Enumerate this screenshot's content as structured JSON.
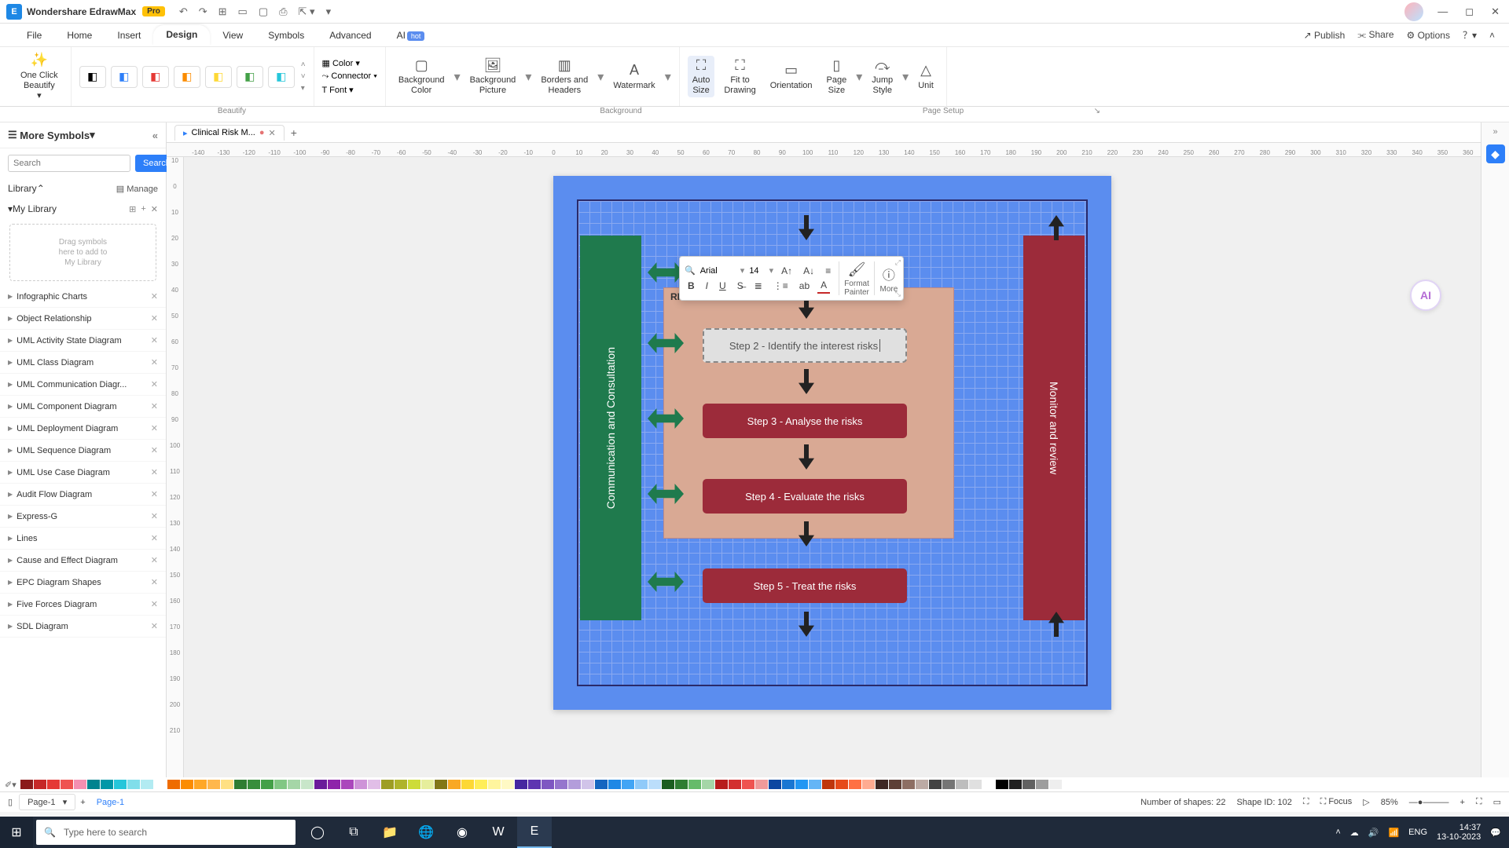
{
  "title": {
    "app": "Wondershare EdrawMax",
    "badge": "Pro"
  },
  "menu": {
    "items": [
      "File",
      "Home",
      "Insert",
      "Design",
      "View",
      "Symbols",
      "Advanced",
      "AI"
    ],
    "active": "Design",
    "hot": "hot",
    "right": {
      "publish": "Publish",
      "share": "Share",
      "options": "Options"
    }
  },
  "ribbon": {
    "one_click": "One Click\nBeautify",
    "color": "Color",
    "connector": "Connector",
    "font": "Font",
    "bg_color": "Background\nColor",
    "bg_picture": "Background\nPicture",
    "borders": "Borders and\nHeaders",
    "watermark": "Watermark",
    "auto_size": "Auto\nSize",
    "fit": "Fit to\nDrawing",
    "orientation": "Orientation",
    "page_size": "Page\nSize",
    "jump_style": "Jump\nStyle",
    "unit": "Unit",
    "groups": {
      "beautify": "Beautify",
      "background": "Background",
      "page_setup": "Page Setup"
    }
  },
  "left": {
    "title": "More Symbols",
    "search_placeholder": "Search",
    "search_btn": "Search",
    "library": "Library",
    "manage": "Manage",
    "mylib": "My Library",
    "dropzone": "Drag symbols\nhere to add to\nMy Library",
    "items": [
      "Infographic Charts",
      "Object Relationship",
      "UML Activity State Diagram",
      "UML Class Diagram",
      "UML Communication Diagr...",
      "UML Component Diagram",
      "UML Deployment Diagram",
      "UML Sequence Diagram",
      "UML Use Case Diagram",
      "Audit Flow Diagram",
      "Express-G",
      "Lines",
      "Cause and Effect Diagram",
      "EPC Diagram Shapes",
      "Five Forces Diagram",
      "SDL Diagram"
    ]
  },
  "doc_tab": {
    "name": "Clinical Risk M...",
    "dirty": "●"
  },
  "ruler_h": [
    "-140",
    "-130",
    "-120",
    "-110",
    "-100",
    "-90",
    "-80",
    "-70",
    "-60",
    "-50",
    "-40",
    "-30",
    "-20",
    "-10",
    "0",
    "10",
    "20",
    "30",
    "40",
    "50",
    "60",
    "70",
    "80",
    "90",
    "100",
    "110",
    "120",
    "130",
    "140",
    "150",
    "160",
    "170",
    "180",
    "190",
    "200",
    "210",
    "220",
    "230",
    "240",
    "250",
    "260",
    "270",
    "280",
    "290",
    "300",
    "310",
    "320",
    "330",
    "340",
    "350",
    "360"
  ],
  "ruler_v": [
    "10",
    "0",
    "10",
    "20",
    "30",
    "40",
    "50",
    "60",
    "70",
    "80",
    "90",
    "100",
    "110",
    "120",
    "130",
    "140",
    "150",
    "160",
    "170",
    "180",
    "190",
    "200",
    "210"
  ],
  "diagram": {
    "left_box": "Communication and Consultation",
    "right_box": "Monitor and review",
    "risk_title": "RISK ASSESSMENT",
    "step2": "Step 2 - Identify the interest risks",
    "step3": "Step 3 - Analyse the risks",
    "step4": "Step 4 - Evaluate the risks",
    "step5": "Step 5 - Treat the risks"
  },
  "float_toolbar": {
    "font": "Arial",
    "size": "14",
    "format_painter": "Format\nPainter",
    "more": "More"
  },
  "palette_colors": [
    "#8b1a1a",
    "#c62828",
    "#e53935",
    "#ef5350",
    "#f48fb1",
    "#00838f",
    "#0097a7",
    "#26c6da",
    "#80deea",
    "#b2ebf2",
    "#ffffff",
    "#ef6c00",
    "#fb8c00",
    "#ffa726",
    "#ffb74d",
    "#ffe082",
    "#2e7d32",
    "#388e3c",
    "#43a047",
    "#81c784",
    "#a5d6a7",
    "#c8e6c9",
    "#6a1b9a",
    "#8e24aa",
    "#ab47bc",
    "#ce93d8",
    "#e1bee7",
    "#9e9d24",
    "#afb42b",
    "#cddc39",
    "#e6ee9c",
    "#827717",
    "#f9a825",
    "#fdd835",
    "#ffee58",
    "#fff59d",
    "#fff9c4",
    "#4527a0",
    "#5e35b1",
    "#7e57c2",
    "#9575cd",
    "#b39ddb",
    "#d1c4e9",
    "#1565c0",
    "#1e88e5",
    "#42a5f5",
    "#90caf9",
    "#bbdefb",
    "#1b5e20",
    "#2e7d32",
    "#66bb6a",
    "#a5d6a7",
    "#b71c1c",
    "#d32f2f",
    "#ef5350",
    "#ef9a9a",
    "#0d47a1",
    "#1976d2",
    "#2196f3",
    "#64b5f6",
    "#bf360c",
    "#e64a19",
    "#ff7043",
    "#ffab91",
    "#3e2723",
    "#5d4037",
    "#8d6e63",
    "#bcaaa4",
    "#424242",
    "#757575",
    "#bdbdbd",
    "#e0e0e0",
    "#ffffff",
    "#000000",
    "#212121",
    "#616161",
    "#9e9e9e",
    "#eeeeee"
  ],
  "status": {
    "page_dd": "Page-1",
    "page_tab": "Page-1",
    "shapes": "Number of shapes: 22",
    "shape_id": "Shape ID: 102",
    "focus": "Focus",
    "zoom": "85%"
  },
  "ai_bubble": "AI",
  "taskbar": {
    "search": "Type here to search",
    "time": "14:37",
    "date": "13-10-2023",
    "lang": "ENG"
  }
}
